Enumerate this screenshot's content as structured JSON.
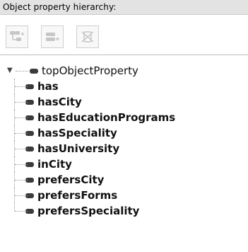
{
  "header": {
    "title": "Object property hierarchy:"
  },
  "toolbar": {
    "buttons": [
      {
        "name": "add-subproperty",
        "icon": "add-sub-property-icon"
      },
      {
        "name": "add-sibling-property",
        "icon": "add-sibling-property-icon"
      },
      {
        "name": "delete-property",
        "icon": "delete-property-icon"
      }
    ]
  },
  "tree": {
    "root": {
      "label": "topObjectProperty",
      "expanded": true
    },
    "children": [
      "has",
      "hasCity",
      "hasEducationPrograms",
      "hasSpeciality",
      "hasUniversity",
      "inCity",
      "prefersCity",
      "prefersForms",
      "prefersSpeciality"
    ]
  },
  "colors": {
    "header_bg": "#e3e3e3",
    "icon": "#3b3b3b",
    "tree_line": "#9a9a9a"
  }
}
